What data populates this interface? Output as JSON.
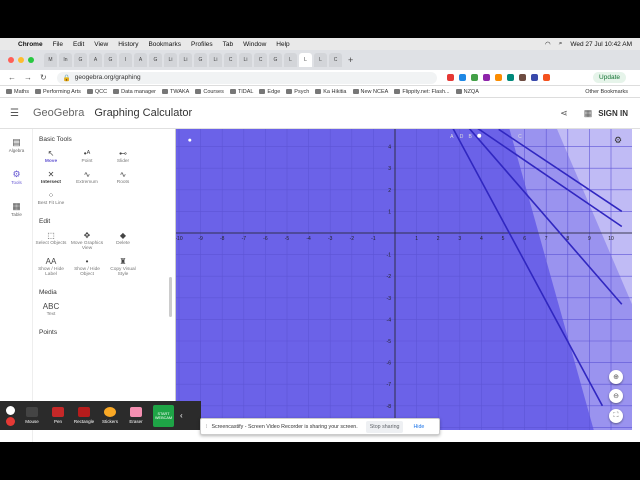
{
  "mac_menu": {
    "app": "Chrome",
    "items": [
      "File",
      "Edit",
      "View",
      "History",
      "Bookmarks",
      "Profiles",
      "Tab",
      "Window",
      "Help"
    ],
    "clock": "Wed 27 Jul  10:42 AM"
  },
  "tabs": [
    "M",
    "In",
    "G",
    "A",
    "G",
    "I",
    "A",
    "G",
    "Li",
    "Li",
    "G",
    "Li",
    "C",
    "Li",
    "C",
    "G",
    "L",
    "L",
    "L",
    "C"
  ],
  "address": {
    "url": "geogebra.org/graphing",
    "update_label": "Update"
  },
  "bookmarks": [
    "Maths",
    "Performing Arts",
    "QCC",
    "Data manager",
    "TWAKA",
    "Courses",
    "TIDAL",
    "Edge",
    "Psych",
    "Ka Hikitia",
    "New NCEA",
    "Flippity.net: Flash...",
    "NZQA"
  ],
  "other_bookmarks": "Other Bookmarks",
  "app": {
    "logo": "GeoGebra",
    "title": "Graphing Calculator",
    "signin": "SIGN IN"
  },
  "rail": [
    {
      "label": "Algebra",
      "icon": "algebra-icon"
    },
    {
      "label": "Tools",
      "icon": "tools-icon"
    },
    {
      "label": "Table",
      "icon": "table-icon"
    }
  ],
  "tools": {
    "basic_title": "Basic Tools",
    "basic": [
      {
        "label": "Move",
        "icon": "move-icon"
      },
      {
        "label": "Point",
        "icon": "point-icon"
      },
      {
        "label": "Slider",
        "icon": "slider-icon"
      },
      {
        "label": "Intersect",
        "icon": "intersect-icon"
      },
      {
        "label": "Extremum",
        "icon": "extremum-icon"
      },
      {
        "label": "Roots",
        "icon": "roots-icon"
      },
      {
        "label": "Best Fit Line",
        "icon": "best-fit-line-icon"
      }
    ],
    "edit_title": "Edit",
    "edit": [
      {
        "label": "Select Objects",
        "icon": "select-objects-icon"
      },
      {
        "label": "Move Graphics View",
        "icon": "move-graphics-view-icon"
      },
      {
        "label": "Delete",
        "icon": "delete-icon"
      },
      {
        "label": "Show / Hide Label",
        "icon": "show-hide-label-icon"
      },
      {
        "label": "Show / Hide Object",
        "icon": "show-hide-object-icon"
      },
      {
        "label": "Copy Visual Style",
        "icon": "copy-visual-style-icon"
      }
    ],
    "media_title": "Media",
    "media": [
      {
        "label": "Text",
        "icon": "text-icon"
      }
    ],
    "points_title": "Points"
  },
  "graph": {
    "x_ticks": [
      "-10",
      "-9",
      "-8",
      "-7",
      "-6",
      "-5",
      "-4",
      "-3",
      "-2",
      "-1",
      "0",
      "1",
      "2",
      "3",
      "4",
      "5",
      "6",
      "7",
      "8",
      "9",
      "10"
    ],
    "y_ticks": [
      "4",
      "3",
      "2",
      "1",
      "-1",
      "-2",
      "-3",
      "-4",
      "-5",
      "-6",
      "-7",
      "-8"
    ],
    "point_labels": [
      "A",
      "B",
      "C",
      "D"
    ],
    "colors": {
      "shade_dark": "#6b62e8",
      "shade_light": "#a9a4f1",
      "line": "#3027c0"
    }
  },
  "castify": {
    "buttons": [
      "Mouse",
      "Pen",
      "Rectangle",
      "Stickers",
      "Eraser"
    ],
    "webcam": "START WEBCAM",
    "share_msg": "Screencastify - Screen Video Recorder is sharing your screen.",
    "stop": "Stop sharing",
    "hide": "Hide"
  }
}
